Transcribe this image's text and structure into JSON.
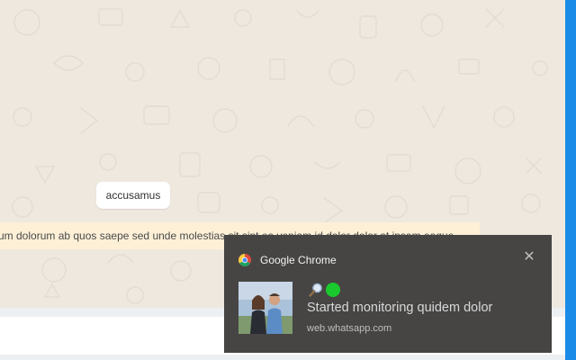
{
  "chat": {
    "bubble_text": "accusamus",
    "highlighted_message": "um dolorum ab quos saepe sed unde molestias sit sint ea veniam id dolor dolor at ipsam eaque"
  },
  "notification": {
    "app_name": "Google Chrome",
    "close_icon": "close-icon",
    "title": "Started monitoring quidem dolor",
    "source": "web.whatsapp.com",
    "icons": [
      "magnifier-icon",
      "green-dot-icon"
    ]
  },
  "colors": {
    "chat_background": "#efe8df",
    "highlight": "#fdf0d7",
    "toast_background": "#464544",
    "accent_blue": "#1a8be6",
    "status_green": "#19c92d"
  }
}
